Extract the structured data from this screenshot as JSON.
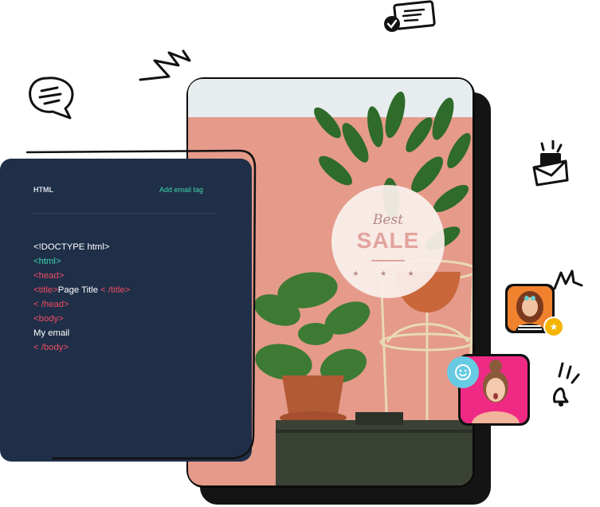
{
  "editor": {
    "tab_html": "HTML",
    "tab_add_email_tag": "Add email tag",
    "code_lines": [
      {
        "text": "<!DOCTYPE html>",
        "color": "#ffffff"
      },
      {
        "text": "<html>",
        "color": "#3fd1a9"
      },
      {
        "text": "<head>",
        "color": "#f04c63"
      },
      {
        "open": "<title>",
        "middle": "Page Title",
        "close": " < /title>"
      },
      {
        "text": "< /head>",
        "color": "#f04c63"
      },
      {
        "text": "<body>",
        "color": "#f04c63"
      },
      {
        "text": "My email",
        "color": "#ffffff"
      },
      {
        "text": "< /body>",
        "color": "#f04c63"
      }
    ]
  },
  "promo": {
    "script_text": "Best",
    "sale_text": "SALE",
    "stars": "★ ★ ★"
  },
  "badges": {
    "star": "★",
    "accent_colors": {
      "editor_bg": "#1f2f48",
      "tag_green": "#3fd1a9",
      "tag_red": "#f04c63",
      "wall": "#e59a8a"
    }
  },
  "icons": [
    "speech-bubble-icon",
    "id-card-check-icon",
    "envelope-icon",
    "bell-icon",
    "smile-icon",
    "star-icon"
  ]
}
